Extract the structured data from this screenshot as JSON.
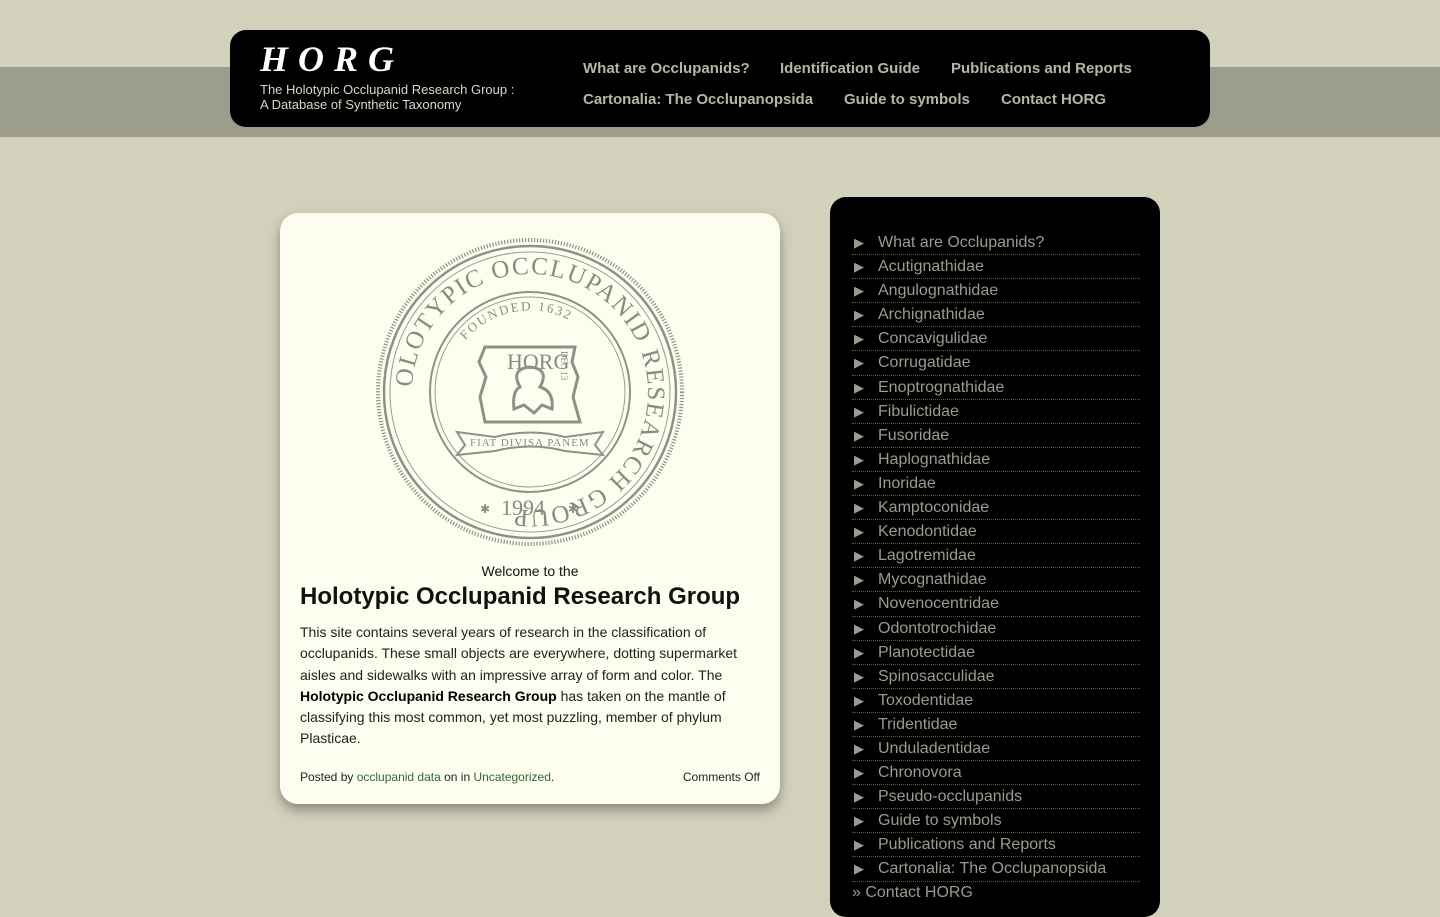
{
  "header": {
    "logo": "HORG",
    "tagline_line1": "The Holotypic Occlupanid Research Group :",
    "tagline_line2": "A Database of Synthetic Taxonomy",
    "nav": [
      {
        "label": "What are Occlupanids?"
      },
      {
        "label": "Identification Guide"
      },
      {
        "label": "Publications and Reports"
      },
      {
        "label": "Cartonalia: The Occlupanopsida"
      },
      {
        "label": "Guide to symbols"
      },
      {
        "label": "Contact HORG"
      }
    ]
  },
  "post": {
    "seal": {
      "ring_text": "HOLOTYPIC OCCLUPANID RESEARCH GROUP",
      "founded": "FOUNDED 1632",
      "center": "HORG",
      "dec": "DEC 13",
      "motto": "FIAT DIVISA PANEM",
      "year": "1994"
    },
    "welcome": "Welcome to the",
    "title": "Holotypic Occlupanid Research Group",
    "body_part1": "This site contains several years of research in the classification of occlupanids. These small objects are everywhere, dotting supermarket aisles and sidewalks with an impressive array of form and color. The ",
    "body_bold": "Holotypic Occlupanid Research Group",
    "body_part2": " has taken on the mantle of classifying this most common, yet most puzzling, member of phylum Plasticae.",
    "meta_posted_by": "Posted by ",
    "meta_author": "occlupanid data",
    "meta_on_in": " on in ",
    "meta_category": "Uncategorized",
    "meta_period": ".",
    "comments": "Comments Off"
  },
  "sidebar": {
    "arrow": "▶",
    "items": [
      "What are Occlupanids?",
      "Acutignathidae",
      "Angulognathidae",
      "Archignathidae",
      "Concavigulidae",
      "Corrugatidae",
      "Enoptrognathidae",
      "Fibulictidae",
      "Fusoridae",
      "Haplognathidae",
      "Inoridae",
      "Kamptoconidae",
      "Kenodontidae",
      "Lagotremidae",
      "Mycognathidae",
      "Novenocentridae",
      "Odontotrochidae",
      "Planotectidae",
      "Spinosacculidae",
      "Toxodentidae",
      "Tridentidae",
      "Unduladentidae",
      "Chronovora",
      "Pseudo-occlupanids",
      "Guide to symbols",
      "Publications and Reports",
      "Cartonalia: The Occlupanopsida"
    ],
    "extra": "» Contact HORG"
  },
  "colors": {
    "page_bg": "#d2d2bc",
    "band": "#9c9d8c",
    "header_bg": "#000000",
    "nav_text": "#b6b6a6",
    "post_bg": "#fdfdf0",
    "link": "#2f6b2f",
    "sidebar_text": "#9b9b8e"
  }
}
